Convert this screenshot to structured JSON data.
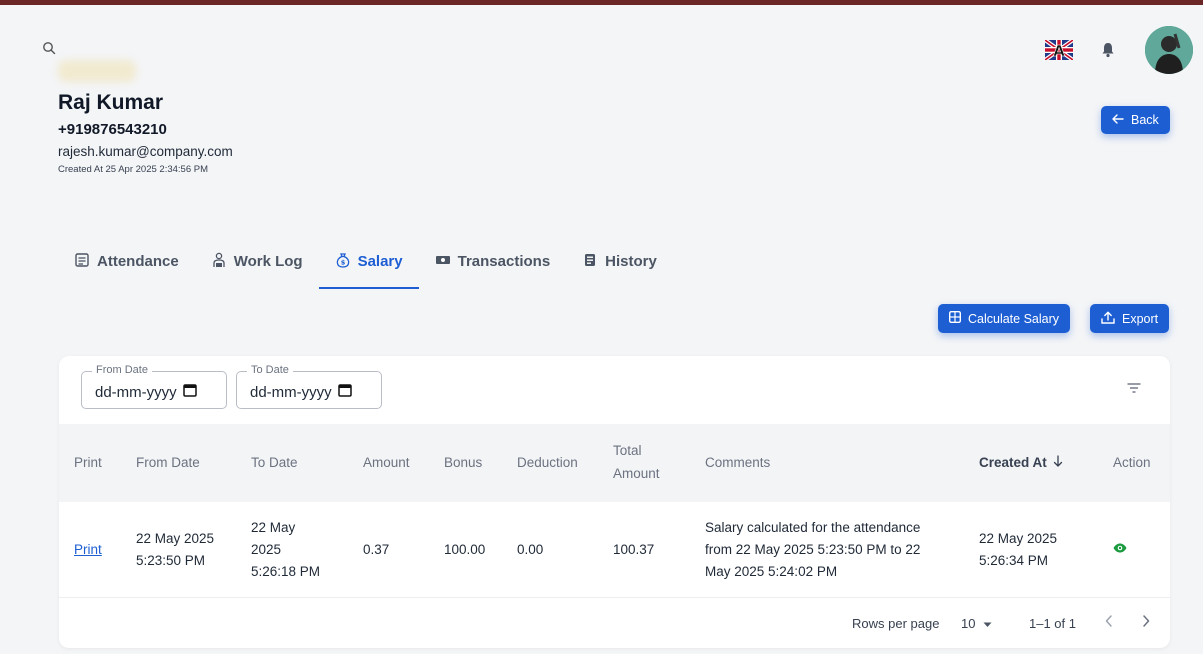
{
  "profile": {
    "name": "Raj Kumar",
    "phone": "+919876543210",
    "email": "rajesh.kumar@company.com",
    "created": "Created At 25 Apr 2025 2:34:56 PM"
  },
  "buttons": {
    "back": "Back",
    "calculate_salary": "Calculate Salary",
    "export": "Export"
  },
  "tabs": [
    {
      "label": "Attendance",
      "icon": "attendance-icon"
    },
    {
      "label": "Work Log",
      "icon": "work-log-icon"
    },
    {
      "label": "Salary",
      "icon": "money-bag-icon",
      "active": true
    },
    {
      "label": "Transactions",
      "icon": "cash-icon"
    },
    {
      "label": "History",
      "icon": "history-icon"
    }
  ],
  "filters": {
    "from_label": "From Date",
    "from_value": "dd-mm-yyyy",
    "to_label": "To Date",
    "to_value": "dd-mm-yyyy"
  },
  "table": {
    "headers": {
      "print": "Print",
      "from_date": "From Date",
      "to_date": "To Date",
      "amount": "Amount",
      "bonus": "Bonus",
      "deduction": "Deduction",
      "total_1": "Total",
      "total_2": "Amount",
      "comments": "Comments",
      "created_at": "Created At",
      "action": "Action"
    },
    "rows": [
      {
        "print": "Print",
        "from_1": "22 May 2025",
        "from_2": "5:23:50 PM",
        "to_1": "22 May",
        "to_2": "2025",
        "to_3": "5:26:18 PM",
        "amount": "0.37",
        "bonus": "100.00",
        "deduction": "0.00",
        "total": "100.37",
        "comment_1": "Salary calculated for the attendance",
        "comment_2": "from 22 May 2025 5:23:50 PM to 22",
        "comment_3": "May 2025 5:24:02 PM",
        "created_1": "22 May 2025",
        "created_2": "5:26:34 PM"
      }
    ]
  },
  "pagination": {
    "rows_per_page_label": "Rows per page",
    "rows_per_page": "10",
    "range": "1–1 of 1"
  },
  "colors": {
    "primary": "#1d5fd3",
    "action_green": "#1b9a3f"
  }
}
